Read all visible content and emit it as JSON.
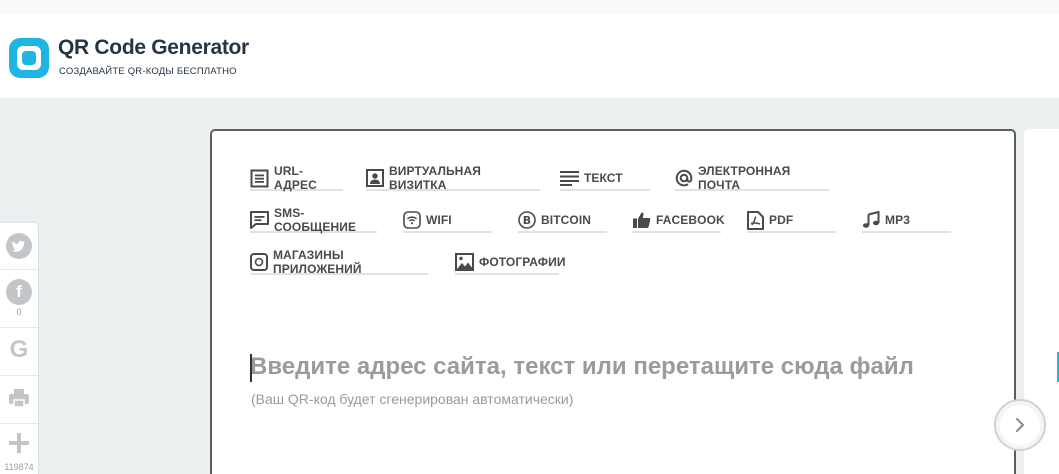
{
  "header": {
    "brand": "QR Code Generator",
    "tagline": "СОЗДАВАЙТЕ QR-КОДЫ БЕСПЛАТНО",
    "logo_icon": "qr-logo-icon",
    "accent_color": "#1fb5e3"
  },
  "social": {
    "items": [
      {
        "icon": "twitter-icon"
      },
      {
        "icon": "facebook-icon",
        "count": "0"
      },
      {
        "icon": "google-icon"
      },
      {
        "icon": "print-icon"
      },
      {
        "icon": "plus-icon",
        "count": "119874"
      }
    ]
  },
  "tabs": [
    {
      "label": "URL-АДРЕС",
      "icon": "url-icon"
    },
    {
      "label": "ВИРТУАЛЬНАЯ ВИЗИТКА",
      "icon": "vcard-icon"
    },
    {
      "label": "ТЕКСТ",
      "icon": "text-icon"
    },
    {
      "label": "ЭЛЕКТРОННАЯ ПОЧТА",
      "icon": "at-icon"
    },
    {
      "label": "SMS-СООБЩЕНИЕ",
      "icon": "sms-icon"
    },
    {
      "label": "WIFI",
      "icon": "wifi-icon"
    },
    {
      "label": "BITCOIN",
      "icon": "bitcoin-icon"
    },
    {
      "label": "FACEBOOK",
      "icon": "facebook-like-icon"
    },
    {
      "label": "PDF",
      "icon": "pdf-icon"
    },
    {
      "label": "MP3",
      "icon": "music-icon"
    },
    {
      "label": "МАГАЗИНЫ ПРИЛОЖЕНИЙ",
      "icon": "app-store-icon"
    },
    {
      "label": "ФОТОГРАФИИ",
      "icon": "photo-icon"
    }
  ],
  "main": {
    "input_placeholder": "Введите адрес сайта, текст или перетащите сюда файл",
    "input_value": "",
    "hint": "(Ваш QR-код будет сгенерирован автоматически)"
  },
  "next_icon": "chevron-right-icon"
}
